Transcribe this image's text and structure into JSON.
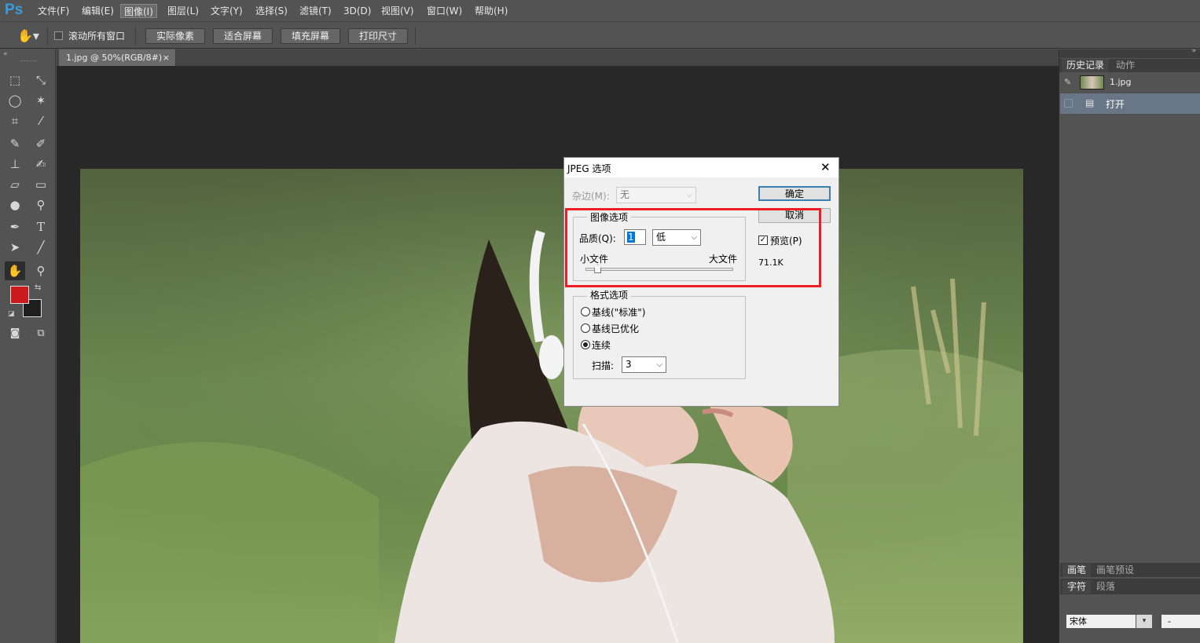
{
  "app": {
    "logo": "Ps"
  },
  "menu": [
    "文件(F)",
    "编辑(E)",
    "图像(I)",
    "图层(L)",
    "文字(Y)",
    "选择(S)",
    "滤镜(T)",
    "3D(D)",
    "视图(V)",
    "窗口(W)",
    "帮助(H)"
  ],
  "options": {
    "scroll_all_label": "滚动所有窗口",
    "btn_actual": "实际像素",
    "btn_fit": "适合屏幕",
    "btn_fill": "填充屏幕",
    "btn_print": "打印尺寸"
  },
  "document": {
    "tab_label": "1.jpg @ 50%(RGB/8#)",
    "close_glyph": "×"
  },
  "panels": {
    "history_tab": "历史记录",
    "actions_tab": "动作",
    "snapshot_label": "1.jpg",
    "history_item": "打开",
    "brush_tab": "画笔",
    "brush_preset_tab": "画笔预设",
    "char_tab": "字符",
    "para_tab": "段落",
    "font_value": "宋体",
    "font_style_value": "-"
  },
  "dialog": {
    "title": "JPEG 选项",
    "matte_label": "杂边(M):",
    "matte_value": "无",
    "ok": "确定",
    "cancel": "取消",
    "image_options_legend": "图像选项",
    "quality_label": "品质(Q):",
    "quality_value": "1",
    "quality_level": "低",
    "small_file": "小文件",
    "large_file": "大文件",
    "quality_slider_fraction": 0.08,
    "preview_label": "预览(P)",
    "file_size": "71.1K",
    "format_legend": "格式选项",
    "radio_baseline": "基线(\"标准\")",
    "radio_optimized": "基线已优化",
    "radio_progressive": "连续",
    "scans_label": "扫描:",
    "scans_value": "3"
  },
  "colors": {
    "foreground": "#cc1b1f",
    "background": "#1e1e1e",
    "highlight": "#ee1c25",
    "accent": "#3a9ddb"
  }
}
